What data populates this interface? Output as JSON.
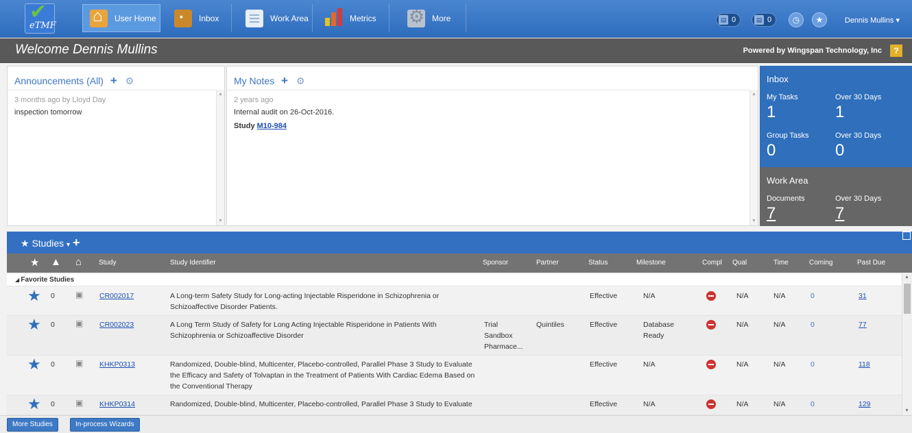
{
  "app": {
    "logo_text": "eTMF"
  },
  "nav": {
    "tabs": [
      {
        "label": "User Home"
      },
      {
        "label": "Inbox"
      },
      {
        "label": "Work Area"
      },
      {
        "label": "Metrics"
      },
      {
        "label": "More"
      }
    ],
    "counter1": "0",
    "counter2": "0",
    "user": "Dennis Mullins"
  },
  "welcome": {
    "title": "Welcome Dennis Mullins",
    "powered": "Powered by Wingspan Technology, Inc",
    "help": "?"
  },
  "announcements": {
    "title": "Announcements (All)",
    "meta": "3 months ago by Lloyd Day",
    "text": "inspection tomorrow"
  },
  "notes": {
    "title": "My Notes",
    "meta": "2 years ago",
    "text": "Internal audit on 26-Oct-2016.",
    "study_prefix": "Study",
    "study_link": "M10-984"
  },
  "inbox": {
    "title": "Inbox",
    "my_tasks_label": "My Tasks",
    "my_tasks": "1",
    "my_over30_label": "Over 30 Days",
    "my_over30": "1",
    "group_tasks_label": "Group Tasks",
    "group_tasks": "0",
    "group_over30_label": "Over 30 Days",
    "group_over30": "0"
  },
  "work_area": {
    "title": "Work Area",
    "docs_label": "Documents",
    "docs": "7",
    "over30_label": "Over 30 Days",
    "over30": "7"
  },
  "studies": {
    "title": "Studies",
    "columns": {
      "study": "Study",
      "identifier": "Study Identifier",
      "sponsor": "Sponsor",
      "partner": "Partner",
      "status": "Status",
      "milestone": "Milestone",
      "compl": "Compl",
      "qual": "Qual",
      "time": "Time",
      "coming": "Coming",
      "past_due": "Past Due"
    },
    "group": "Favorite Studies",
    "rows": [
      {
        "count": "0",
        "study": "CR002017",
        "identifier": "A Long-term Safety Study for Long-acting Injectable Risperidone in Schizophrenia or Schizoaffective Disorder Patients.",
        "sponsor": "",
        "partner": "",
        "status": "Effective",
        "milestone": "N/A",
        "qual": "N/A",
        "time": "N/A",
        "coming": "0",
        "past_due": "31"
      },
      {
        "count": "0",
        "study": "CR002023",
        "identifier": "A Long Term Study of Safety for Long Acting Injectable Risperidone in Patients With Schizophrenia or Schizoaffective Disorder",
        "sponsor": "Trial Sandbox Pharmace...",
        "partner": "Quintiles",
        "status": "Effective",
        "milestone": "Database Ready",
        "qual": "N/A",
        "time": "N/A",
        "coming": "0",
        "past_due": "77"
      },
      {
        "count": "0",
        "study": "KHKP0313",
        "identifier": "Randomized, Double-blind, Multicenter, Placebo-controlled, Parallel Phase 3 Study to Evaluate the Efficacy and Safety of Tolvaptan in the Treatment of Patients With Cardiac Edema Based on the Conventional Therapy",
        "sponsor": "",
        "partner": "",
        "status": "Effective",
        "milestone": "N/A",
        "qual": "N/A",
        "time": "N/A",
        "coming": "0",
        "past_due": "118"
      },
      {
        "count": "0",
        "study": "KHKP0314",
        "identifier": "Randomized, Double-blind, Multicenter, Placebo-controlled, Parallel Phase 3 Study to Evaluate",
        "sponsor": "",
        "partner": "",
        "status": "Effective",
        "milestone": "N/A",
        "qual": "N/A",
        "time": "N/A",
        "coming": "0",
        "past_due": "129"
      }
    ]
  },
  "footer": {
    "more_studies": "More Studies",
    "wizards": "In-process Wizards"
  }
}
